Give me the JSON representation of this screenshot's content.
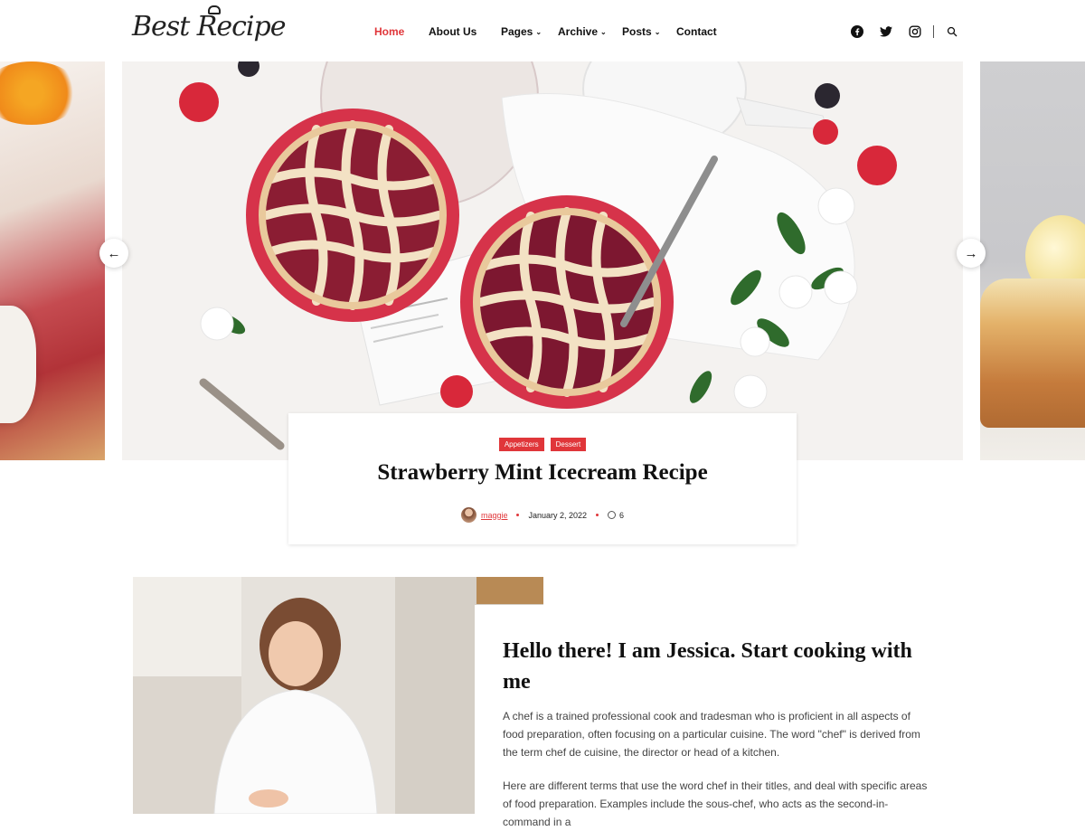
{
  "header": {
    "logo_text": "Best Recipe",
    "nav": [
      {
        "label": "Home",
        "active": true,
        "has_dropdown": false
      },
      {
        "label": "About Us",
        "active": false,
        "has_dropdown": false
      },
      {
        "label": "Pages",
        "active": false,
        "has_dropdown": true
      },
      {
        "label": "Archive",
        "active": false,
        "has_dropdown": true
      },
      {
        "label": "Posts",
        "active": false,
        "has_dropdown": true
      },
      {
        "label": "Contact",
        "active": false,
        "has_dropdown": false
      }
    ],
    "social_icons": [
      "facebook-icon",
      "twitter-icon",
      "instagram-icon"
    ],
    "search_icon": "search-icon"
  },
  "slider": {
    "prev_icon": "arrow-left-icon",
    "next_icon": "arrow-right-icon"
  },
  "featured_post": {
    "categories": [
      "Appetizers",
      "Dessert"
    ],
    "title": "Strawberry Mint Icecream Recipe",
    "author": "maggie",
    "date": "January 2, 2022",
    "comments": "6"
  },
  "about": {
    "title": "Hello there! I am Jessica. Start cooking with me",
    "paragraph_1": "A chef is a trained professional cook and tradesman who is proficient in all aspects of food preparation, often focusing on a particular cuisine. The word \"chef\" is derived from the term chef de cuisine, the director or head of a kitchen.",
    "paragraph_2": "Here are different terms that use the word chef in their titles, and deal with specific areas of food preparation. Examples include the sous-chef, who acts as the second-in-command in a"
  },
  "colors": {
    "accent": "#e0363a",
    "text": "#111111",
    "body_text": "#444444"
  }
}
